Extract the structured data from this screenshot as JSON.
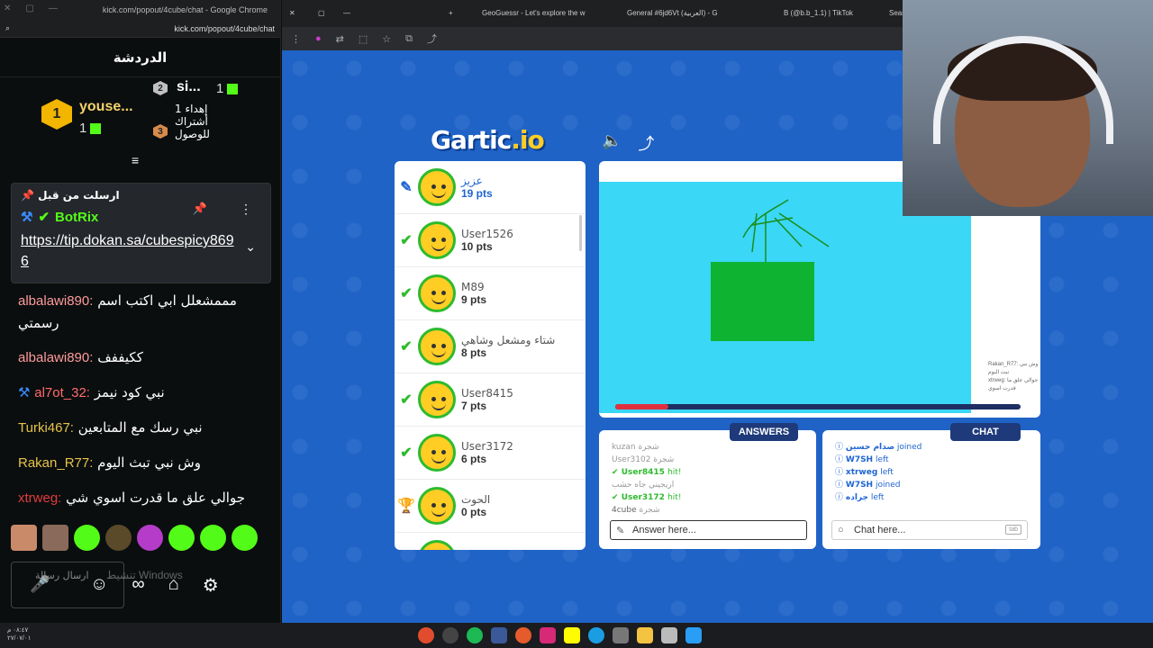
{
  "kick": {
    "window_title": "kick.com/popout/4cube/chat - Google Chrome",
    "url": "kick.com/popout/4cube/chat",
    "header": "الدردشة",
    "leaders": [
      {
        "rank": "1",
        "name": "youse...",
        "count": "1"
      },
      {
        "rank": "2",
        "name": "si...",
        "count": "1"
      },
      {
        "rank": "3",
        "name": "إهداء أشتراك للوصول",
        "count": "1"
      }
    ],
    "pinned": {
      "title": "ارسلت من قبل",
      "user": "BotRix",
      "link": "https://tip.dokan.sa/cubespicy8696"
    },
    "messages": [
      {
        "user": "albalawi890:",
        "text": "مممشعلل ابي اكتب اسم رسمتي",
        "color": "#ff9b9b"
      },
      {
        "user": "albalawi890:",
        "text": "ككيففف",
        "color": "#ff9b9b"
      },
      {
        "user": "al7ot_32:",
        "text": "نبي كود نيمز",
        "color": "#ff6b6b"
      },
      {
        "user": "Turki467:",
        "text": "نبي رسك مع المتابعين",
        "color": "#e6c44a"
      },
      {
        "user": "Rakan_R77:",
        "text": "وش نبي تبث اليوم",
        "color": "#e6c44a"
      },
      {
        "user": "xtrweg:",
        "text": "جوالي علق ما قدرت اسوي شي",
        "color": "#e03c3c"
      }
    ],
    "input_placeholder": "ارسال رسالة",
    "watermark": "تنشيط Windows"
  },
  "browser": {
    "tabs": [
      "GeoGuessr - Let's explore the w",
      "General #6jd6Vt (العربية) - G",
      "B (@b.b_1.1) | TikTok",
      "Sear"
    ]
  },
  "gartic": {
    "logo_main": "Gartic",
    "logo_suffix": ".io",
    "players": [
      {
        "name": "عزيز",
        "pts": "19 pts",
        "status": "drawing"
      },
      {
        "name": "User1526",
        "pts": "10 pts",
        "status": "hit"
      },
      {
        "name": "M89",
        "pts": "9 pts",
        "status": "hit"
      },
      {
        "name": "شتاء ومشعل وشاهي",
        "pts": "8 pts",
        "status": "hit"
      },
      {
        "name": "User8415",
        "pts": "7 pts",
        "status": "hit"
      },
      {
        "name": "User3172",
        "pts": "6 pts",
        "status": "hit"
      },
      {
        "name": "الحوت",
        "pts": "0 pts",
        "status": "none"
      },
      {
        "name": "4cube",
        "pts": "",
        "status": "none"
      }
    ],
    "timer_progress": 0.13,
    "overlay_chat": [
      "Rakan_R77: وش نبي تبث اليوم",
      "xtrweg: جوالي علق ما قدرت اسوي"
    ],
    "answers": {
      "tag": "ANSWERS",
      "lines": [
        {
          "user": "kuzan",
          "text": "شجرة",
          "type": "plain"
        },
        {
          "user": "User3102",
          "text": "شجرة",
          "type": "plain"
        },
        {
          "user": "User8415",
          "text": "hit!",
          "type": "hit"
        },
        {
          "user": "",
          "text": "اريجيني جاه حشب",
          "type": "plain"
        },
        {
          "user": "User3172",
          "text": "hit!",
          "type": "hit"
        },
        {
          "user": "4cube",
          "text": "شجرة",
          "type": "plain"
        }
      ],
      "placeholder": "Answer here..."
    },
    "chat": {
      "tag": "CHAT",
      "lines": [
        {
          "user": "صدام حسين",
          "action": "joined"
        },
        {
          "user": "W7SH",
          "action": "left"
        },
        {
          "user": "xtrweg",
          "action": "left"
        },
        {
          "user": "W7SH",
          "action": "joined"
        },
        {
          "user": "جراده",
          "action": "left"
        }
      ],
      "placeholder": "Chat here...",
      "tab_key": "tab"
    }
  },
  "taskbar": {
    "time": "٠٨:٤٧ م",
    "date": "٢٧/٠٧/٠١"
  }
}
